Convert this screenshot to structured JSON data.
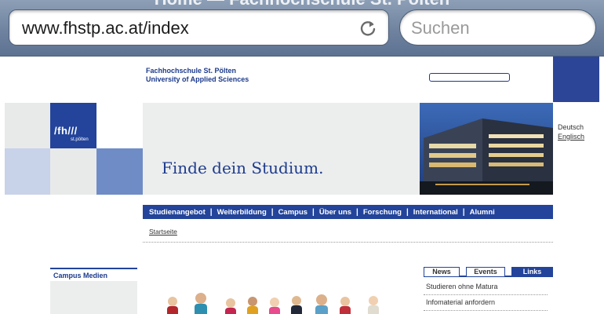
{
  "browser": {
    "page_title": "Home — Fachhochschule St. Pölten",
    "url": "www.fhstp.ac.at/index",
    "search_placeholder": "Suchen"
  },
  "header": {
    "name_line1": "Fachhochschule St. Pölten",
    "name_line2": "University of Applied Sciences"
  },
  "logo": {
    "text": "/fh///",
    "subtext": "st.pölten"
  },
  "banner": {
    "tagline": "Finde dein Studium."
  },
  "language": {
    "current": "Deutsch",
    "other": "Englisch"
  },
  "nav": {
    "items": [
      "Studienangebot",
      "Weiterbildung",
      "Campus",
      "Über uns",
      "Forschung",
      "International",
      "Alumni"
    ]
  },
  "breadcrumb": "Startseite",
  "sidebar": {
    "campus_medien": "Campus Medien"
  },
  "tabs": {
    "news": "News",
    "events": "Events",
    "links": "Links"
  },
  "links": [
    "Studieren ohne Matura",
    "Infomaterial anfordern"
  ],
  "colors": {
    "brand_blue": "#23449a",
    "chrome": "#6f83a0"
  }
}
